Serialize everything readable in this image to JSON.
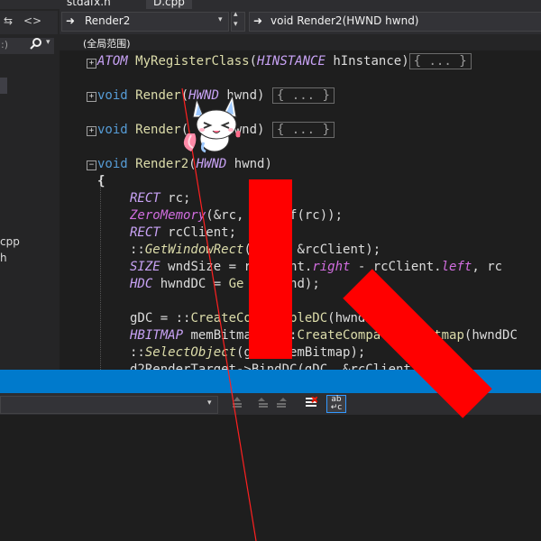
{
  "tabs": {
    "left_tab": "stdafx.h",
    "active_tab": "D.cpp"
  },
  "left_panel": {
    "search_placeholder": ":)",
    "file_1": "cpp",
    "file_2": "h"
  },
  "navbar": {
    "class_combo": "Render2",
    "member_combo": "void Render2(HWND hwnd)",
    "scope": "(全局范围)"
  },
  "code": {
    "collapsed_marker": "{ ... }",
    "l1_type": "ATOM",
    "l1_name": "MyRegisterClass",
    "l1_ptype": "HINSTANCE",
    "l1_pname": "hInstance",
    "l3_void": "void",
    "l3_name": "Render",
    "l3_ptype": "HWND",
    "l3_pname": "hwnd",
    "l5_void": "void",
    "l5_name": "Render",
    "l5_pname": "hwnd",
    "l7_void": "void",
    "l7_name": "Render2",
    "l7_ptype": "HWND",
    "l7_pname": "hwnd",
    "brace": "{",
    "l9_type": "RECT",
    "l9_rest": "rc;",
    "l10_fn": "ZeroMemory",
    "l10_rest": "(&rc, sizeof(rc));",
    "l11_type": "RECT",
    "l11_rest": "rcClient;",
    "l12_scope": "::",
    "l12_fn": "GetWindowRect",
    "l12_rest": "(    , &rcClient);",
    "l13_type": "SIZE",
    "l13_a": "wndSize = rcClient.",
    "l13_right": "right",
    "l13_b": " - rcClient.",
    "l13_left": "left",
    "l13_c": ", rc",
    "l14_type": "HDC",
    "l14_a": "hwndDC = ",
    "l14_fn": "Ge",
    "l14_b": "(hwnd);",
    "l16_a": "gDC = ::",
    "l16_fn": "CreateCompatibleDC",
    "l16_b": "(hwndDC",
    "l17_type": "HBITMAP",
    "l17_a": "memBitmap = ::",
    "l17_fn": "CreateCompatibleBitmap",
    "l17_b": "(hwndDC",
    "l18_scope": "::",
    "l18_fn": "SelectObject",
    "l18_b": "(gDC, memBitmap);",
    "l19_a": "d2RenderTarget->BindDC(gDC, &rcClient"
  },
  "icons": {
    "left_arrow": "⇆",
    "code_brackets": "<>",
    "search": "🔍",
    "drop": "▾",
    "nav_arrow": "➜",
    "spin_up": "▴",
    "spin_down": "▾",
    "wrap": "ab\n↵c"
  },
  "colors": {
    "accent_blue": "#007acc",
    "overlay_red": "#ff0000"
  }
}
